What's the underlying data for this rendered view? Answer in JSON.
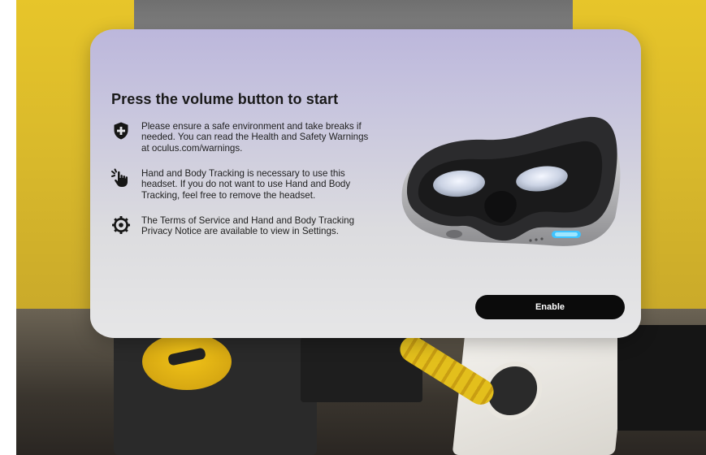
{
  "dialog": {
    "title": "Press the volume button to start",
    "items": [
      {
        "icon": "shield-plus-icon",
        "text": "Please ensure a safe environment and take breaks if needed. You can read the Health and Safety Warnings at oculus.com/warnings."
      },
      {
        "icon": "hand-pointer-icon",
        "text": "Hand and Body Tracking is necessary to use this headset. If you do not want to use Hand and Body Tracking, feel free to remove the headset."
      },
      {
        "icon": "settings-gear-icon",
        "text": "The Terms of Service and Hand and Body Tracking Privacy Notice are available to view in Settings."
      }
    ],
    "enable_label": "Enable"
  },
  "colors": {
    "button_bg": "#0b0b0b",
    "button_text": "#ffffff",
    "panel_top": "#bcb7dc",
    "panel_bottom": "#e6e6e7",
    "headset_led": "#3fc3ff"
  }
}
